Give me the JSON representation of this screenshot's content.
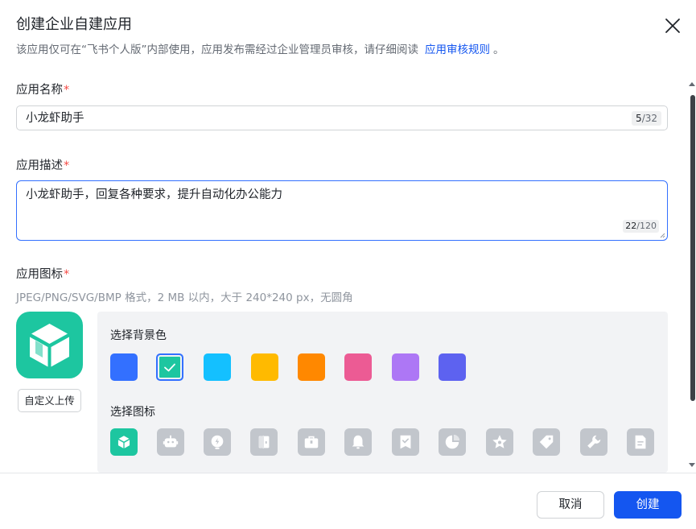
{
  "dialog": {
    "title": "创建企业自建应用",
    "subtitle": "该应用仅可在“飞书个人版”内部使用，应用发布需经过企业管理员审核，请仔细阅读",
    "subtitle_link": "应用审核规则",
    "subtitle_end": "。"
  },
  "form": {
    "name": {
      "label": "应用名称",
      "required_mark": "*",
      "value": "小龙虾助手",
      "count": "5",
      "max": "/32"
    },
    "description": {
      "label": "应用描述",
      "required_mark": "*",
      "value": "小龙虾助手，回复各种要求，提升自动化办公能力",
      "count": "22",
      "max": "/120"
    },
    "icon": {
      "label": "应用图标",
      "required_mark": "*",
      "hint": "JPEG/PNG/SVG/BMP 格式，2 MB 以内，大于 240*240 px，无圆角",
      "upload_label": "自定义上传",
      "bg_section_label": "选择背景色",
      "icon_section_label": "选择图标",
      "background_colors": [
        "#3370ff",
        "#1dc6a0",
        "#14c0ff",
        "#ffba00",
        "#ff8800",
        "#ec5b94",
        "#ad77f5",
        "#5d62f0"
      ],
      "selected_background": "#1dc6a0",
      "icons": [
        "cube-icon",
        "robot-icon",
        "lightbulb-icon",
        "door-icon",
        "briefcase-icon",
        "bell-icon",
        "checklist-icon",
        "pie-chart-icon",
        "star-badge-icon",
        "tag-icon",
        "wrench-icon",
        "document-icon"
      ],
      "selected_icon": "cube-icon"
    }
  },
  "footer": {
    "cancel_label": "取消",
    "create_label": "创建"
  }
}
